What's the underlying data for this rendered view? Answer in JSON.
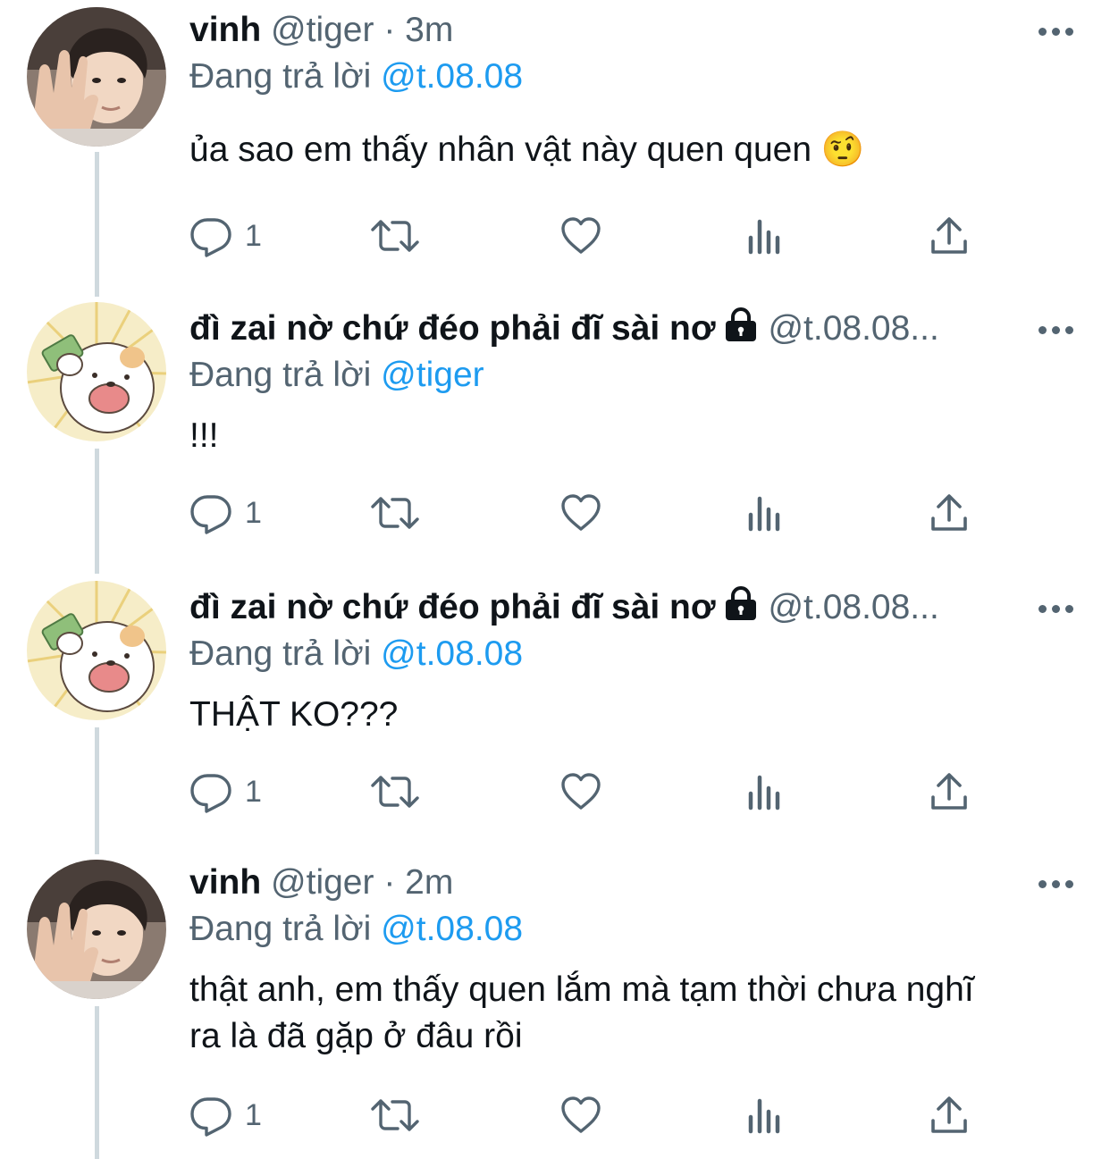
{
  "tweets": [
    {
      "name": "vinh",
      "handle": "@tiger",
      "time": "3m",
      "reply_prefix": "Đang trả lời",
      "reply_mention": "@t.08.08",
      "text": "ủa sao em thấy nhân vật này quen quen 🤨",
      "reply_count": "1",
      "avatar": "person-photo"
    },
    {
      "name": "đì zai nờ chứ đéo phải đĩ sài nơ",
      "handle": "@t.08.08...",
      "time": "",
      "reply_prefix": "Đang trả lời",
      "reply_mention": "@tiger",
      "text": "!!!",
      "reply_count": "1",
      "avatar": "cartoon-dog",
      "locked": true
    },
    {
      "name": "đì zai nờ chứ đéo phải đĩ sài nơ",
      "handle": "@t.08.08...",
      "time": "",
      "reply_prefix": "Đang trả lời",
      "reply_mention": "@t.08.08",
      "text": "THẬT KO???",
      "reply_count": "1",
      "avatar": "cartoon-dog",
      "locked": true
    },
    {
      "name": "vinh",
      "handle": "@tiger",
      "time": "2m",
      "reply_prefix": "Đang trả lời",
      "reply_mention": "@t.08.08",
      "text_line1": "thật anh, em thấy quen lắm mà tạm thời chưa nghĩ",
      "text_line2": "ra là đã gặp ở đâu rồi",
      "reply_count": "1",
      "avatar": "person-photo"
    }
  ],
  "separator": "·",
  "colors": {
    "accent": "#1d9bf0",
    "secondary": "#536471",
    "thread_line": "#cfd9de"
  }
}
